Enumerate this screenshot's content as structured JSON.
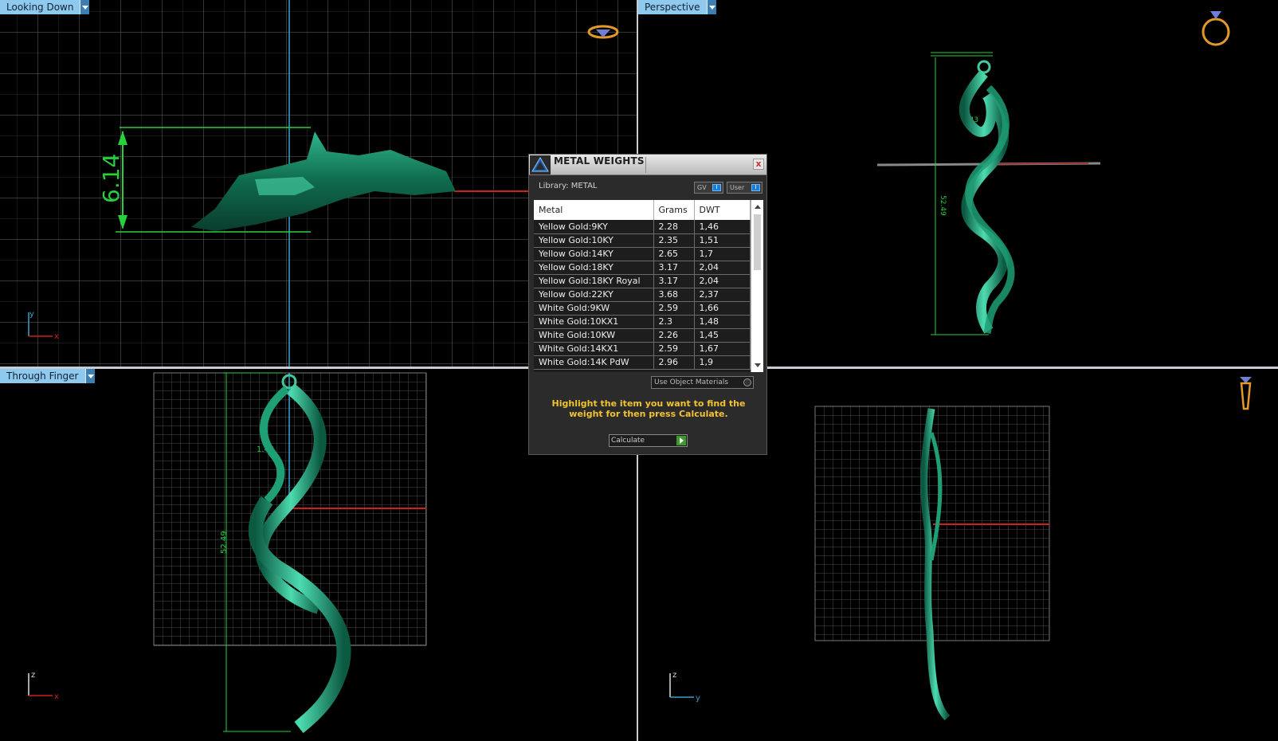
{
  "viewports": {
    "top_left": {
      "label": "Looking Down",
      "dimension": "6.14",
      "axes": [
        "y",
        "x"
      ]
    },
    "top_right": {
      "label": "Perspective",
      "dimension_height": "52.49",
      "dimension_small": "1.43"
    },
    "bottom_left": {
      "label": "Through Finger",
      "dimension_height": "52.49",
      "dimension_small": "1.43",
      "axes": [
        "z",
        "x"
      ]
    },
    "bottom_right": {
      "label": "",
      "axes": [
        "z",
        "y"
      ]
    }
  },
  "dialog": {
    "title": "METAL WEIGHTS",
    "close_label": "x",
    "library": "Library: METAL",
    "toggle_gv": "GV",
    "toggle_user": "User",
    "columns": [
      "Metal",
      "Grams",
      "DWT"
    ],
    "rows": [
      {
        "metal": "Yellow Gold:9KY",
        "grams": "2.28",
        "dwt": "1,46"
      },
      {
        "metal": "Yellow Gold:10KY",
        "grams": "2.35",
        "dwt": "1,51"
      },
      {
        "metal": "Yellow Gold:14KY",
        "grams": "2.65",
        "dwt": "1,7"
      },
      {
        "metal": "Yellow Gold:18KY",
        "grams": "3.17",
        "dwt": "2,04"
      },
      {
        "metal": "Yellow Gold:18KY Royal",
        "grams": "3.17",
        "dwt": "2,04"
      },
      {
        "metal": "Yellow Gold:22KY",
        "grams": "3.68",
        "dwt": "2,37"
      },
      {
        "metal": "White Gold:9KW",
        "grams": "2.59",
        "dwt": "1,66"
      },
      {
        "metal": "White Gold:10KX1",
        "grams": "2.3",
        "dwt": "1,48"
      },
      {
        "metal": "White Gold:10KW",
        "grams": "2.26",
        "dwt": "1,45"
      },
      {
        "metal": "White Gold:14KX1",
        "grams": "2.59",
        "dwt": "1,67"
      },
      {
        "metal": "White Gold:14K PdW",
        "grams": "2.96",
        "dwt": "1,9"
      }
    ],
    "use_object_materials": "Use Object Materials",
    "hint": "Highlight the item you want to find the weight for then press Calculate.",
    "calculate": "Calculate"
  },
  "colors": {
    "model": "#1f8f6a",
    "grid": "#5a5a5a",
    "dimension": "#27d13c",
    "accent_blue": "#8fc9ee",
    "hint": "#f1c232"
  }
}
